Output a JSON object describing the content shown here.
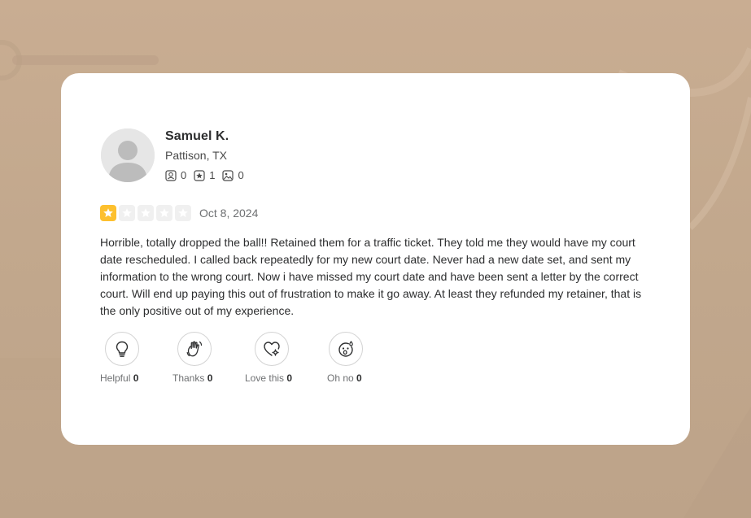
{
  "review": {
    "reviewer": {
      "name": "Samuel K.",
      "location": "Pattison, TX",
      "avatar_icon": "default-user-avatar-icon"
    },
    "stats": {
      "friends": "0",
      "reviews": "1",
      "photos": "0",
      "friends_icon": "friends-icon",
      "reviews_icon": "reviews-star-icon",
      "photos_icon": "photo-icon"
    },
    "rating": {
      "stars": 1,
      "max_stars": 5,
      "star_color": "#fdc02e",
      "empty_color": "#f0f0f0"
    },
    "date": "Oct 8, 2024",
    "text": "Horrible, totally dropped the ball!! Retained them for a traffic ticket. They told me they would have my court date rescheduled. I called back repeatedly for my new court date. Never had a new date set, and sent my information to the wrong court. Now i have missed my court date and have been sent a letter by the correct court. Will end up paying this out of frustration to make it go away. At least they refunded my retainer, that is the only positive out of my experience.",
    "reactions": [
      {
        "label": "Helpful",
        "count": "0",
        "icon": "lightbulb-icon"
      },
      {
        "label": "Thanks",
        "count": "0",
        "icon": "waving-hand-icon"
      },
      {
        "label": "Love this",
        "count": "0",
        "icon": "heart-sparkle-icon"
      },
      {
        "label": "Oh no",
        "count": "0",
        "icon": "surprised-face-icon"
      }
    ]
  }
}
